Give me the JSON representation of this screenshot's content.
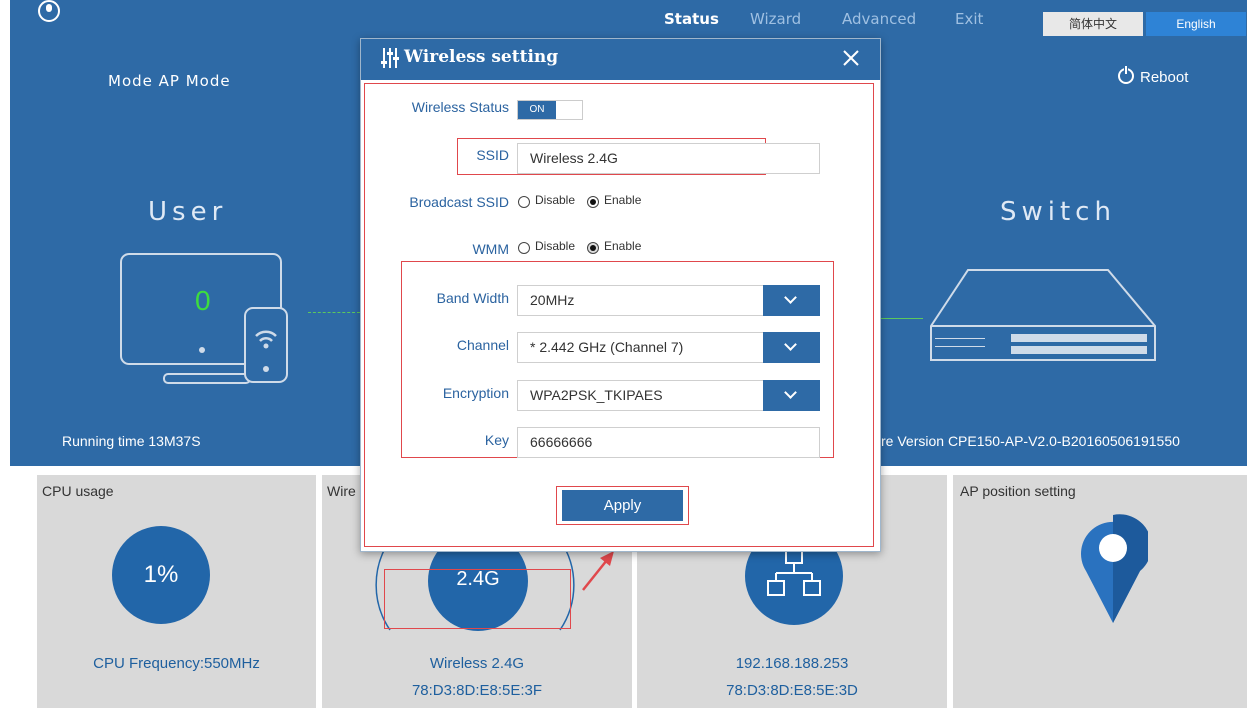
{
  "nav": {
    "items": [
      {
        "label": "Status"
      },
      {
        "label": "Wizard"
      },
      {
        "label": "Advanced"
      },
      {
        "label": "Exit"
      }
    ],
    "lang_cn": "简体中文",
    "lang_en": "English"
  },
  "status": {
    "mode_label": "Mode",
    "mode_value": "AP Mode",
    "reboot_label": "Reboot",
    "user_title": "User",
    "user_count": "0",
    "switch_title": "Switch",
    "running_time_label": "Running time",
    "running_time_value": "13M37S",
    "firmware_label": "re Version",
    "firmware_value": "CPE150-AP-V2.0-B20160506191550"
  },
  "panels": {
    "cpu": {
      "title": "CPU usage",
      "value": "1%",
      "frequency": "CPU Frequency:550MHz"
    },
    "wireless": {
      "title": "Wire",
      "band": "2.4G",
      "name": "Wireless 2.4G",
      "mac": "78:D3:8D:E8:5E:3F"
    },
    "lan": {
      "ip": "192.168.188.253",
      "mac": "78:D3:8D:E8:5E:3D"
    },
    "ap_position": {
      "title": "AP position setting"
    }
  },
  "modal": {
    "title": "Wireless setting",
    "wireless_status_label": "Wireless Status",
    "wireless_status_value": "ON",
    "ssid_label": "SSID",
    "ssid_value": "Wireless 2.4G",
    "broadcast_label": "Broadcast SSID",
    "wmm_label": "WMM",
    "disable_label": "Disable",
    "enable_label": "Enable",
    "bandwidth_label": "Band Width",
    "bandwidth_value": "20MHz",
    "channel_label": "Channel",
    "channel_value": "* 2.442 GHz (Channel 7)",
    "encryption_label": "Encryption",
    "encryption_value": "WPA2PSK_TKIPAES",
    "key_label": "Key",
    "key_value": "66666666",
    "apply_label": "Apply"
  },
  "colors": {
    "primary_blue": "#2e6aa6",
    "panel_gray": "#d9d9d9",
    "highlight_red": "#e0484c",
    "user_count_green": "#3ddc3d"
  }
}
